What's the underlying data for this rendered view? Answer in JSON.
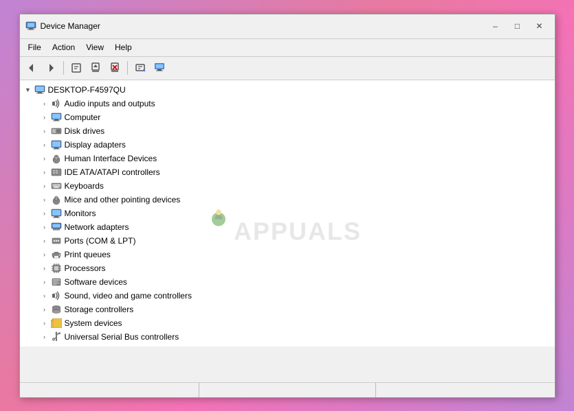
{
  "window": {
    "title": "Device Manager",
    "icon": "device-manager-icon"
  },
  "menu": {
    "items": [
      {
        "id": "file",
        "label": "File"
      },
      {
        "id": "action",
        "label": "Action"
      },
      {
        "id": "view",
        "label": "View"
      },
      {
        "id": "help",
        "label": "Help"
      }
    ]
  },
  "toolbar": {
    "buttons": [
      {
        "id": "back",
        "symbol": "◀",
        "tooltip": "Back"
      },
      {
        "id": "forward",
        "symbol": "▶",
        "tooltip": "Forward"
      },
      {
        "id": "properties",
        "symbol": "⊟",
        "tooltip": "Properties"
      },
      {
        "id": "update",
        "symbol": "↑",
        "tooltip": "Update Driver"
      },
      {
        "id": "uninstall",
        "symbol": "✕",
        "tooltip": "Uninstall"
      },
      {
        "id": "scan",
        "symbol": "⊞",
        "tooltip": "Scan for hardware changes"
      },
      {
        "id": "monitor",
        "symbol": "▣",
        "tooltip": "Open Device Manager"
      }
    ]
  },
  "root_node": {
    "name": "DESKTOP-F4597QU",
    "icon": "computer-icon"
  },
  "tree_items": [
    {
      "id": "audio",
      "label": "Audio inputs and outputs",
      "icon": "🔊",
      "icon_color": "#777"
    },
    {
      "id": "computer",
      "label": "Computer",
      "icon": "💻",
      "icon_color": "#4a7cc7"
    },
    {
      "id": "disk",
      "label": "Disk drives",
      "icon": "💾",
      "icon_color": "#777"
    },
    {
      "id": "display",
      "label": "Display adapters",
      "icon": "🖥",
      "icon_color": "#4a7cc7"
    },
    {
      "id": "hid",
      "label": "Human Interface Devices",
      "icon": "🎮",
      "icon_color": "#777"
    },
    {
      "id": "ide",
      "label": "IDE ATA/ATAPI controllers",
      "icon": "⊞",
      "icon_color": "#777"
    },
    {
      "id": "keyboards",
      "label": "Keyboards",
      "icon": "⌨",
      "icon_color": "#777"
    },
    {
      "id": "mice",
      "label": "Mice and other pointing devices",
      "icon": "🖱",
      "icon_color": "#777"
    },
    {
      "id": "monitors",
      "label": "Monitors",
      "icon": "🖥",
      "icon_color": "#4a7cc7"
    },
    {
      "id": "network",
      "label": "Network adapters",
      "icon": "📡",
      "icon_color": "#4a7cc7"
    },
    {
      "id": "ports",
      "label": "Ports (COM & LPT)",
      "icon": "🔌",
      "icon_color": "#777"
    },
    {
      "id": "print",
      "label": "Print queues",
      "icon": "🖨",
      "icon_color": "#777"
    },
    {
      "id": "proc",
      "label": "Processors",
      "icon": "⚙",
      "icon_color": "#777"
    },
    {
      "id": "software",
      "label": "Software devices",
      "icon": "📦",
      "icon_color": "#777"
    },
    {
      "id": "sound",
      "label": "Sound, video and game controllers",
      "icon": "🔊",
      "icon_color": "#777"
    },
    {
      "id": "storage",
      "label": "Storage controllers",
      "icon": "💽",
      "icon_color": "#777"
    },
    {
      "id": "system",
      "label": "System devices",
      "icon": "📁",
      "icon_color": "#777"
    },
    {
      "id": "usb",
      "label": "Universal Serial Bus controllers",
      "icon": "🔌",
      "icon_color": "#777"
    }
  ],
  "status": {
    "text": ""
  }
}
